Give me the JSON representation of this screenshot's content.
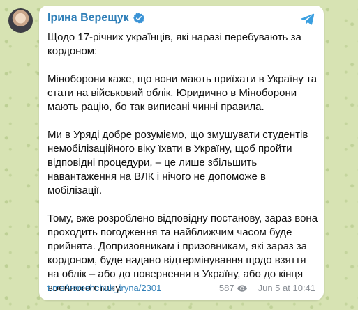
{
  "post": {
    "author": "Ірина Верещук",
    "paragraphs": [
      "Щодо 17-річних українців, які наразі перебувають за кордоном:",
      "Міноборони каже, що вони мають приїхати в Україну та стати на військовий облік. Юридично в Міноборони мають рацію, бо так виписані чинні правила.",
      "Ми в Уряді добре розуміємо, що змушувати студентів немобілізаційного віку їхати в Україну, щоб пройти відповідні процедури, – це лише збільшить навантаження на ВЛК і нічого не допоможе в мобілізації.",
      "Тому, вже розроблено відповідну постанову, зараз вона проходить погодження та найближчим часом буде прийнята. Допризовникам і призовникам, які зараз за кордоном, буде надано відтермінування щодо взяття на облік – або до повернення в Україну, або до кінця воєнного стану."
    ],
    "link": "t.me/vereshchuk_iryna/2301",
    "views": "587",
    "date": "Jun 5 at 10:41"
  },
  "icons": {
    "verified": "verified-badge-icon",
    "telegram": "telegram-icon",
    "views": "eye-icon"
  },
  "colors": {
    "accent": "#2f7fb8",
    "background": "#d7e3b3",
    "bubble": "#ffffff"
  }
}
